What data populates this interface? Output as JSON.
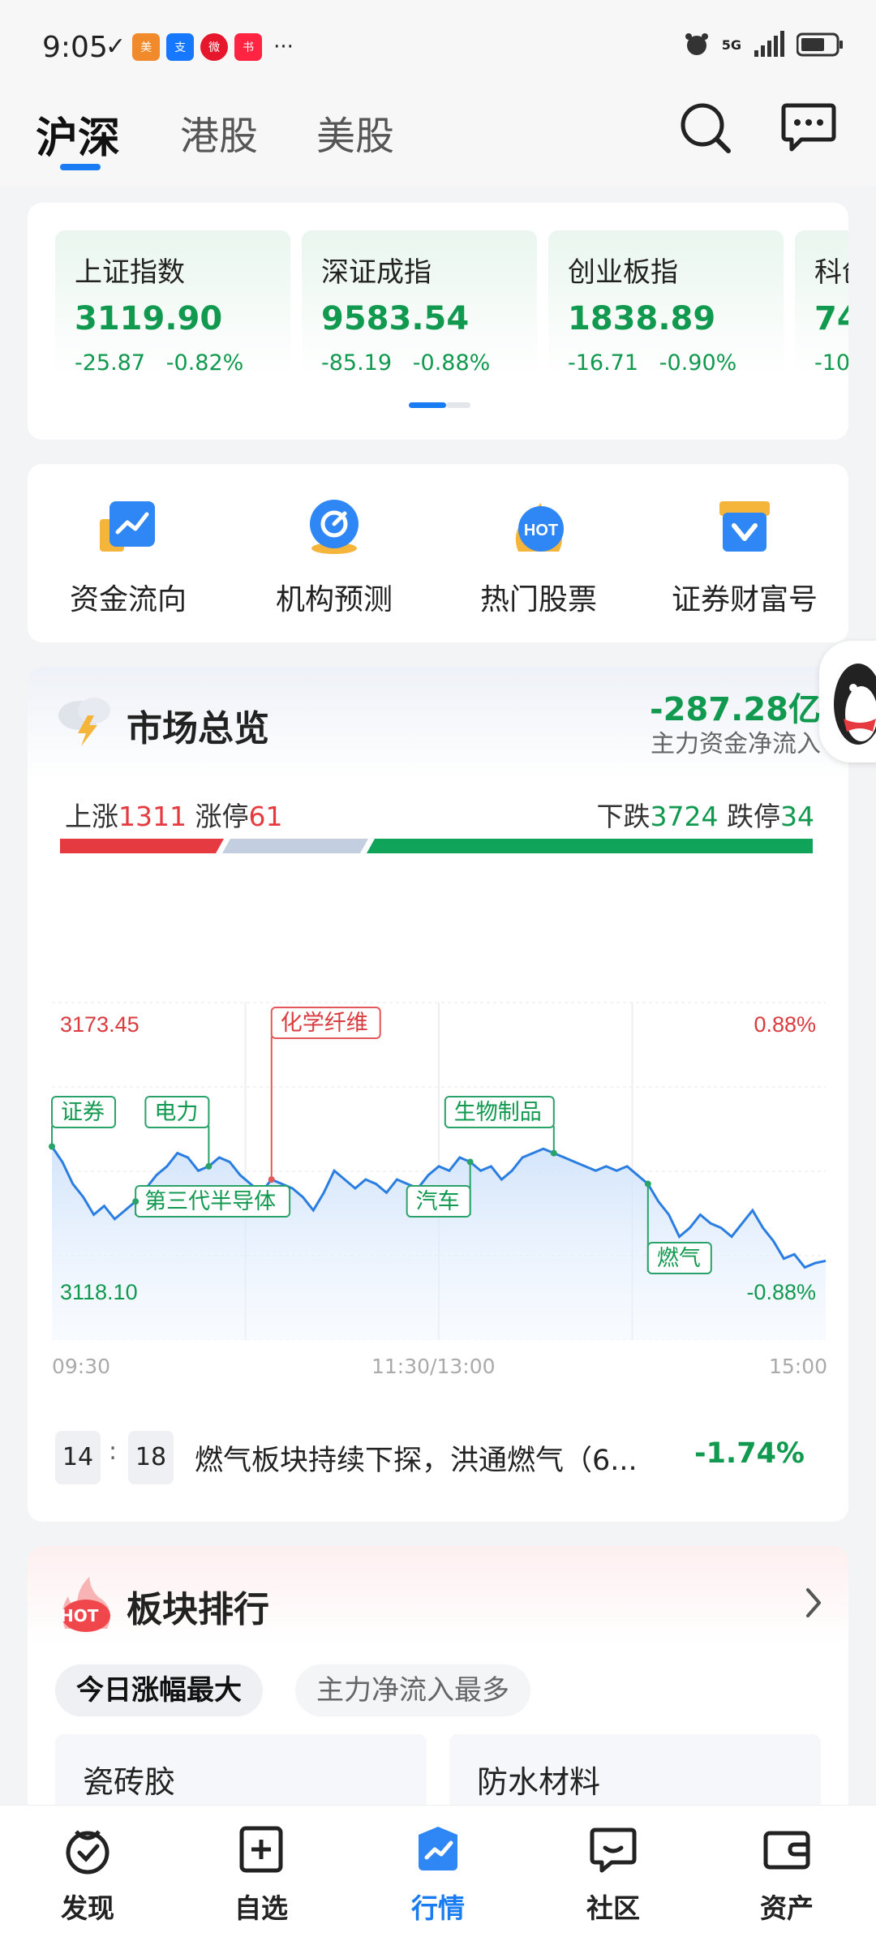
{
  "status_bar": {
    "time": "9:05",
    "more": "···",
    "network": "5G"
  },
  "top_tabs": [
    {
      "label": "沪深",
      "active": true
    },
    {
      "label": "港股",
      "active": false
    },
    {
      "label": "美股",
      "active": false
    }
  ],
  "indices": [
    {
      "name": "上证指数",
      "value": "3119.90",
      "change": "-25.87",
      "pct": "-0.82%"
    },
    {
      "name": "深证成指",
      "value": "9583.54",
      "change": "-85.19",
      "pct": "-0.88%"
    },
    {
      "name": "创业板指",
      "value": "1838.89",
      "change": "-16.71",
      "pct": "-0.90%"
    },
    {
      "name": "科创",
      "value": "74",
      "change": "-10",
      "pct": ""
    }
  ],
  "quick_entries": [
    {
      "label": "资金流向",
      "icon": "fund-flow-icon"
    },
    {
      "label": "机构预测",
      "icon": "institution-forecast-icon"
    },
    {
      "label": "热门股票",
      "icon": "hot-stocks-icon"
    },
    {
      "label": "证券财富号",
      "icon": "wealth-account-icon"
    }
  ],
  "market_overview": {
    "title": "市场总览",
    "net_inflow": "-287.28亿",
    "net_inflow_label": "主力资金净流入",
    "up_label": "上涨",
    "up_count": "1311",
    "limit_up_label": "涨停",
    "limit_up_count": "61",
    "down_label": "下跌",
    "down_count": "3724",
    "limit_down_label": "跌停",
    "limit_down_count": "34",
    "breadth_fraction_up": 0.21,
    "breadth_fraction_flat": 0.16,
    "news_hour": "14",
    "news_minute": "18",
    "news_text": "燃气板块持续下探，洪通燃气（6...",
    "news_pct": "-1.74%"
  },
  "chart_data": {
    "type": "line",
    "y_high_label": "3173.45",
    "y_low_label": "3118.10",
    "pct_high_label": "0.88%",
    "pct_low_label": "-0.88%",
    "x_labels": [
      "09:30",
      "11:30/13:00",
      "15:00"
    ],
    "ylim": [
      3118.1,
      3173.45
    ],
    "series": [
      {
        "values": [
          3145.5,
          3142,
          3137,
          3134,
          3130,
          3132,
          3129,
          3131,
          3133,
          3136,
          3139,
          3141,
          3144,
          3143,
          3140,
          3141,
          3143,
          3142,
          3139,
          3137,
          3135,
          3138,
          3137,
          3136,
          3134,
          3131,
          3135,
          3140,
          3138,
          3136,
          3138,
          3137,
          3135,
          3138,
          3137,
          3136,
          3139,
          3141,
          3140,
          3143,
          3142,
          3140,
          3141,
          3138,
          3140,
          3143,
          3144,
          3145,
          3144,
          3143,
          3142,
          3141,
          3140,
          3141,
          3140,
          3141,
          3139,
          3137,
          3133,
          3130,
          3125,
          3127,
          3130,
          3128,
          3127,
          3125,
          3128,
          3131,
          3127,
          3124,
          3120,
          3121,
          3118,
          3119,
          3119.5
        ]
      }
    ],
    "annotations": [
      {
        "label": "证券",
        "color": "green"
      },
      {
        "label": "第三代半导体",
        "color": "green"
      },
      {
        "label": "电力",
        "color": "green"
      },
      {
        "label": "化学纤维",
        "color": "red"
      },
      {
        "label": "汽车",
        "color": "green"
      },
      {
        "label": "生物制品",
        "color": "green"
      },
      {
        "label": "燃气",
        "color": "green"
      }
    ]
  },
  "sector_ranking": {
    "title": "板块排行",
    "hot_badge": "HOT",
    "tabs": [
      {
        "label": "今日涨幅最大",
        "active": true
      },
      {
        "label": "主力净流入最多",
        "active": false
      }
    ],
    "items": [
      {
        "name": "瓷砖胶"
      },
      {
        "name": "防水材料"
      }
    ]
  },
  "bottom_nav": [
    {
      "label": "发现",
      "icon": "discover-icon"
    },
    {
      "label": "自选",
      "icon": "watchlist-icon"
    },
    {
      "label": "行情",
      "icon": "market-icon",
      "active": true
    },
    {
      "label": "社区",
      "icon": "community-icon"
    },
    {
      "label": "资产",
      "icon": "assets-icon"
    }
  ],
  "colors": {
    "up_red": "#e53a3f",
    "down_green": "#10994f",
    "accent_blue": "#1a7cf2",
    "line_blue": "#2a7de1"
  }
}
